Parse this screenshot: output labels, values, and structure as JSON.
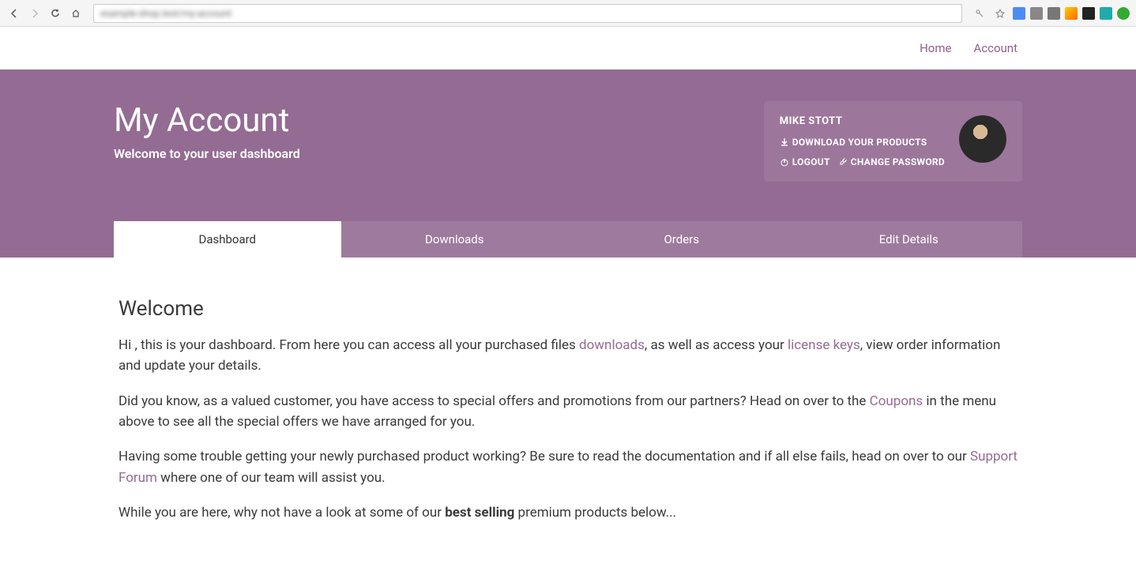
{
  "topnav": {
    "home": "Home",
    "account": "Account"
  },
  "hero": {
    "title": "My Account",
    "subtitle": "Welcome to your user dashboard"
  },
  "user": {
    "name": "MIKE STOTT",
    "download_products": "DOWNLOAD YOUR PRODUCTS",
    "logout": "LOGOUT",
    "change_password": "CHANGE PASSWORD"
  },
  "tabs": {
    "dashboard": "Dashboard",
    "downloads": "Downloads",
    "orders": "Orders",
    "edit_details": "Edit Details"
  },
  "content": {
    "welcome_heading": "Welcome",
    "p1_a": "Hi , this is your dashboard. From here you can access all your purchased files ",
    "p1_link1": "downloads",
    "p1_b": ", as well as access your ",
    "p1_link2": "license keys",
    "p1_c": ", view order information and update your details.",
    "p2_a": "Did you know, as a valued customer, you have access to special offers and promotions from our partners? Head on over to the ",
    "p2_link": "Coupons",
    "p2_b": " in the menu above to see all the special offers we have arranged for you.",
    "p3_a": "Having some trouble getting your newly purchased product working? Be sure to read the documentation and if all else fails, head on over to our ",
    "p3_link": "Support Forum",
    "p3_b": " where one of our team will assist you.",
    "p4_a": "While you are here, why not have a look at some of our ",
    "p4_bold": "best selling",
    "p4_b": " premium products below..."
  }
}
